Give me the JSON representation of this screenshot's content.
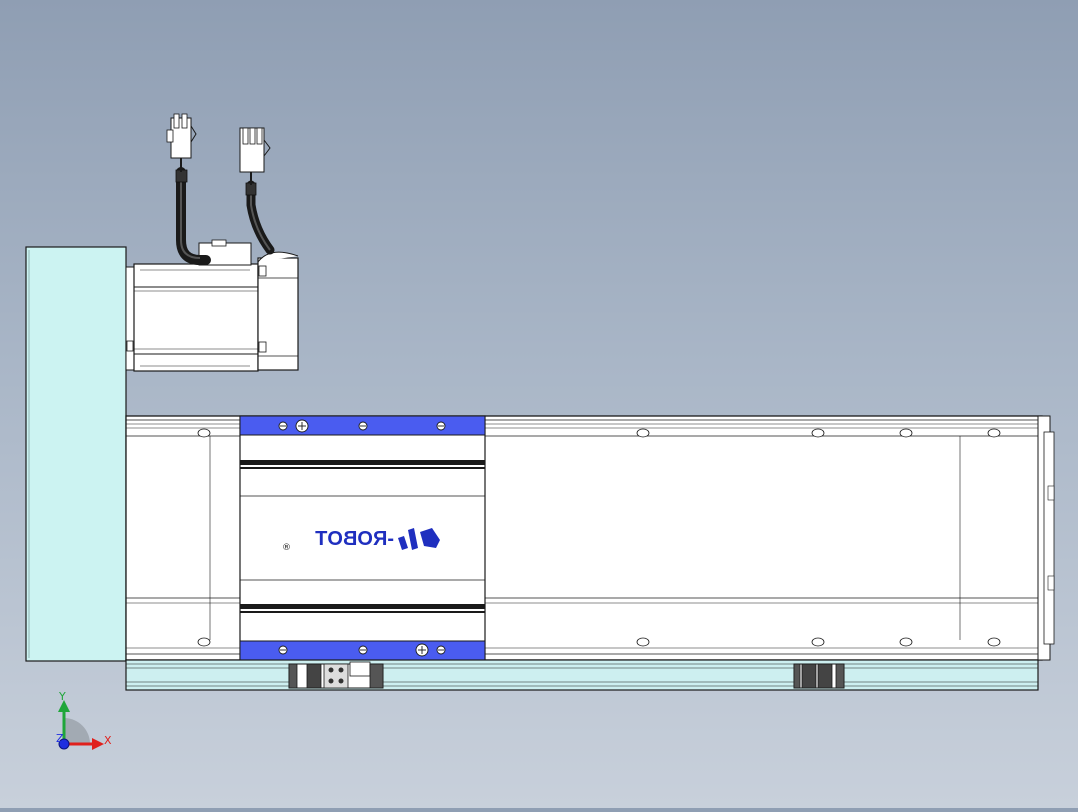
{
  "view": {
    "background_top": "#8f9eb3",
    "background_bottom": "#c8d0db"
  },
  "logo": {
    "text": "-ROBOT",
    "registered_mark": "®",
    "color": "#1f2fbf"
  },
  "triad": {
    "x_label": "X",
    "y_label": "Y",
    "z_label": "Z",
    "x_color": "#e0201c",
    "y_color": "#1fa63a",
    "z_color": "#1f2fe0"
  },
  "colors": {
    "end_plate": "#ccf3f2",
    "carriage_cap": "#4a5cf0",
    "body": "#ffffff",
    "outline": "#1a1a1a",
    "rail": "#cdeff0"
  },
  "icons": [
    "motor-cable-connector-icon",
    "screw-head-icon",
    "robot-logo-icon",
    "coordinate-triad-icon"
  ]
}
